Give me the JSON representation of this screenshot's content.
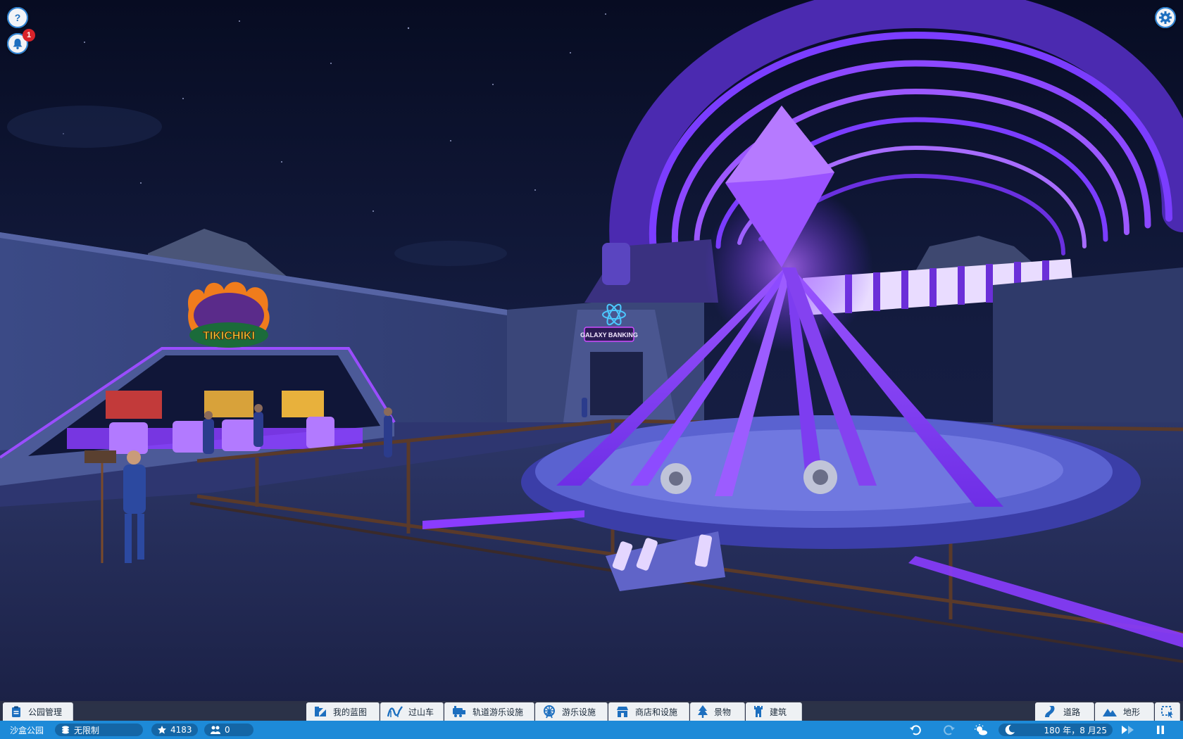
{
  "scene": {
    "sign_tikichiki": "TIKICHIKI",
    "sign_galaxy": "GALAXY BANKING"
  },
  "top_left": {
    "help_icon": "help-icon",
    "notification_icon": "bell-icon",
    "notification_count": "1"
  },
  "top_right": {
    "settings_icon": "gear-icon"
  },
  "toolbar": {
    "park_management": "公园管理",
    "tabs": [
      {
        "label": "我的蓝图",
        "icon": "blueprint-icon"
      },
      {
        "label": "过山车",
        "icon": "coaster-icon"
      },
      {
        "label": "轨道游乐设施",
        "icon": "train-icon"
      },
      {
        "label": "游乐设施",
        "icon": "ferris-wheel-icon"
      },
      {
        "label": "商店和设施",
        "icon": "shop-icon"
      },
      {
        "label": "景物",
        "icon": "tree-icon"
      },
      {
        "label": "建筑",
        "icon": "tower-icon"
      }
    ],
    "right_tabs": [
      {
        "label": "道路",
        "icon": "path-icon"
      },
      {
        "label": "地形",
        "icon": "terrain-icon"
      }
    ]
  },
  "status": {
    "park_name": "沙盒公园",
    "money": "无限制",
    "rating": "4183",
    "guests": "0",
    "date": "180 年，8 月25"
  },
  "colors": {
    "accent_blue": "#1d8ad8",
    "neon_purple": "#8a3cff",
    "night_sky": "#0c1430"
  }
}
